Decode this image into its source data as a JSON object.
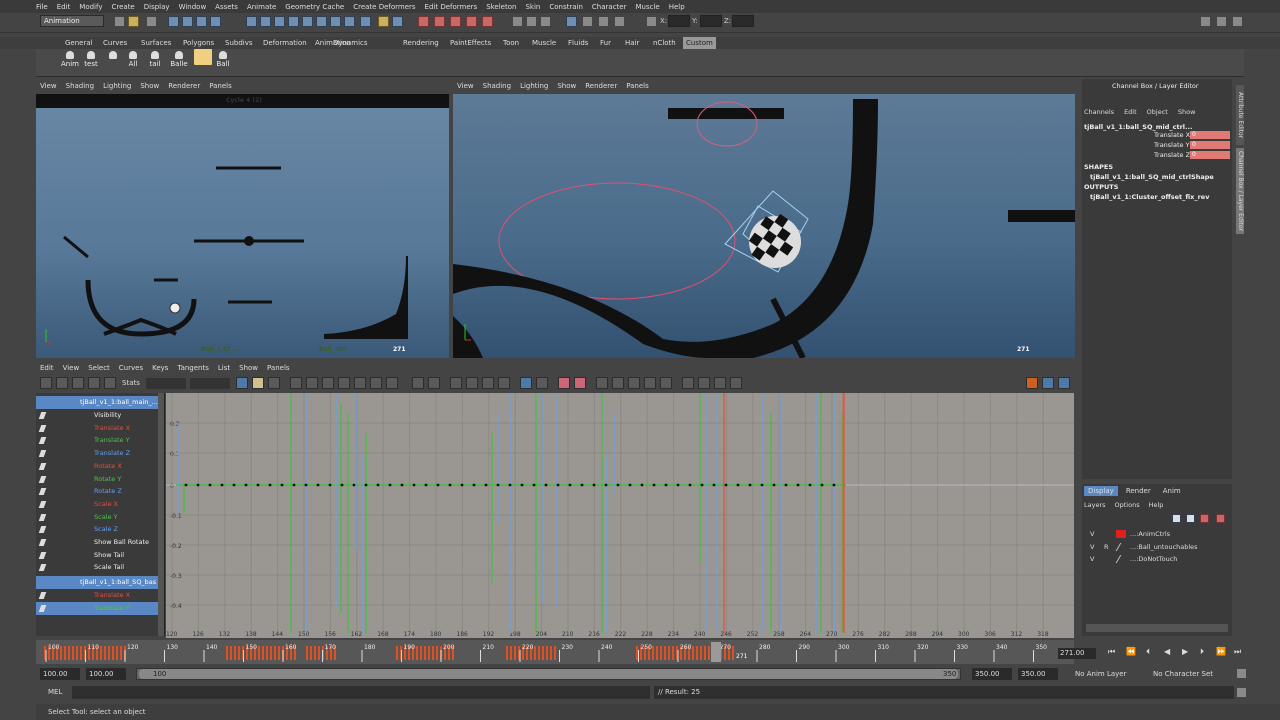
{
  "menubar": [
    "File",
    "Edit",
    "Modify",
    "Create",
    "Display",
    "Window",
    "Assets",
    "Animate",
    "Geometry Cache",
    "Create Deformers",
    "Edit Deformers",
    "Skeleton",
    "Skin",
    "Constrain",
    "Character",
    "Muscle",
    "Help"
  ],
  "statusline": {
    "mode": "Animation",
    "x_label": "X:",
    "y_label": "Y:",
    "z_label": "Z:"
  },
  "shelf_tabs": [
    "General",
    "Curves",
    "Surfaces",
    "Polygons",
    "Subdivs",
    "Deformation",
    "Animation",
    "Dynamics",
    "Rendering",
    "PaintEffects",
    "Toon",
    "Muscle",
    "Fluids",
    "Fur",
    "Hair",
    "nCloth",
    "Custom"
  ],
  "shelf_tabs_active": "Custom",
  "shelf_items": [
    {
      "label": "Anim"
    },
    {
      "label": "test"
    },
    {
      "label": ""
    },
    {
      "label": "All"
    },
    {
      "label": "tail"
    },
    {
      "label": "Balle"
    },
    {
      "label": ""
    },
    {
      "label": "Ball"
    }
  ],
  "panel_menu": [
    "View",
    "Shading",
    "Lighting",
    "Show",
    "Renderer",
    "Panels"
  ],
  "left_viewport": {
    "header_text": "Cycle 4 (2)",
    "frame": "271",
    "footer_text": "Ball_1,Cl_...",
    "footer_text2": "Ball_ctrl"
  },
  "right_viewport": {
    "frame": "271"
  },
  "graph_menu": [
    "Edit",
    "View",
    "Select",
    "Curves",
    "Keys",
    "Tangents",
    "List",
    "Show",
    "Panels"
  ],
  "graph_stats_label": "Stats",
  "outliner": {
    "header": "tjBall_v1_1:ball_main_...",
    "attrs": [
      {
        "label": "Visibility",
        "color": "#eeeeee"
      },
      {
        "label": "Translate X",
        "color": "#e05040"
      },
      {
        "label": "Translate Y",
        "color": "#50c050"
      },
      {
        "label": "Translate Z",
        "color": "#60a0f0"
      },
      {
        "label": "Rotate X",
        "color": "#e05040"
      },
      {
        "label": "Rotate Y",
        "color": "#50c050"
      },
      {
        "label": "Rotate Z",
        "color": "#60a0f0"
      },
      {
        "label": "Scale X",
        "color": "#e05040"
      },
      {
        "label": "Scale Y",
        "color": "#50c050"
      },
      {
        "label": "Scale Z",
        "color": "#60a0f0"
      },
      {
        "label": "Show Ball Rotate",
        "color": "#eeeeee"
      },
      {
        "label": "Show Tail",
        "color": "#eeeeee"
      },
      {
        "label": "Scale Tail",
        "color": "#eeeeee"
      }
    ],
    "header2": "tjBall_v1_1:ball_SQ_bas",
    "attrs2": [
      {
        "label": "Translate X",
        "color": "#e05040"
      },
      {
        "label": "Translate Y",
        "color": "#50c050"
      }
    ]
  },
  "graph": {
    "y_ticks": [
      "0.2",
      "0.1",
      "0",
      "-0.1",
      "-0.2",
      "-0.3",
      "-0.4"
    ],
    "x_ticks": [
      "120",
      "126",
      "132",
      "138",
      "144",
      "150",
      "156",
      "162",
      "168",
      "174",
      "180",
      "186",
      "192",
      "198",
      "204",
      "210",
      "216",
      "222",
      "228",
      "234",
      "240",
      "246",
      "252",
      "258",
      "264",
      "270",
      "276",
      "282",
      "288",
      "294",
      "300",
      "306",
      "312",
      "318"
    ]
  },
  "channel_box": {
    "title": "Channel Box / Layer Editor",
    "menus": [
      "Channels",
      "Edit",
      "Object",
      "Show"
    ],
    "object": "tjBall_v1_1:ball_SQ_mid_ctrl...",
    "channels": [
      "Translate X",
      "Translate Y",
      "Translate Z"
    ],
    "channel_values": [
      "0",
      "0",
      "0"
    ],
    "shapes_label": "SHAPES",
    "shape": "tjBall_v1_1:ball_SQ_mid_ctrlShape",
    "outputs_label": "OUTPUTS",
    "output": "tjBall_v1_1:Cluster_offset_fix_rev"
  },
  "layer_editor": {
    "tabs": [
      "Display",
      "Render",
      "Anim"
    ],
    "active_tab": "Display",
    "menus": [
      "Layers",
      "Options",
      "Help"
    ],
    "layers": [
      {
        "v": "V",
        "r": "",
        "name": "...:AnimCtrls",
        "color": "#e02020"
      },
      {
        "v": "V",
        "r": "R",
        "name": "...:Ball_untouchables",
        "color": ""
      },
      {
        "v": "V",
        "r": "",
        "name": "...:DoNotTouch",
        "color": ""
      }
    ]
  },
  "side_tabs": [
    "Attribute Editor",
    "Channel Box / Layer Editor"
  ],
  "timeslider": {
    "ticks": [
      "100",
      "110",
      "120",
      "130",
      "140",
      "150",
      "160",
      "170",
      "180",
      "190",
      "200",
      "210",
      "220",
      "230",
      "240",
      "250",
      "260",
      "270",
      "280",
      "290",
      "300",
      "310",
      "320",
      "330",
      "340",
      "350"
    ],
    "current": "271",
    "current_field": "271.00"
  },
  "range": {
    "start": "100.00",
    "inner_start": "100.00",
    "range_start": "100",
    "range_end": "350",
    "inner_end": "350.00",
    "end": "350.00",
    "anim_layer": "No Anim Layer",
    "char_set": "No Character Set"
  },
  "cmdline": {
    "label": "MEL",
    "result": "// Result: 25"
  },
  "helpline": "Select Tool: select an object"
}
